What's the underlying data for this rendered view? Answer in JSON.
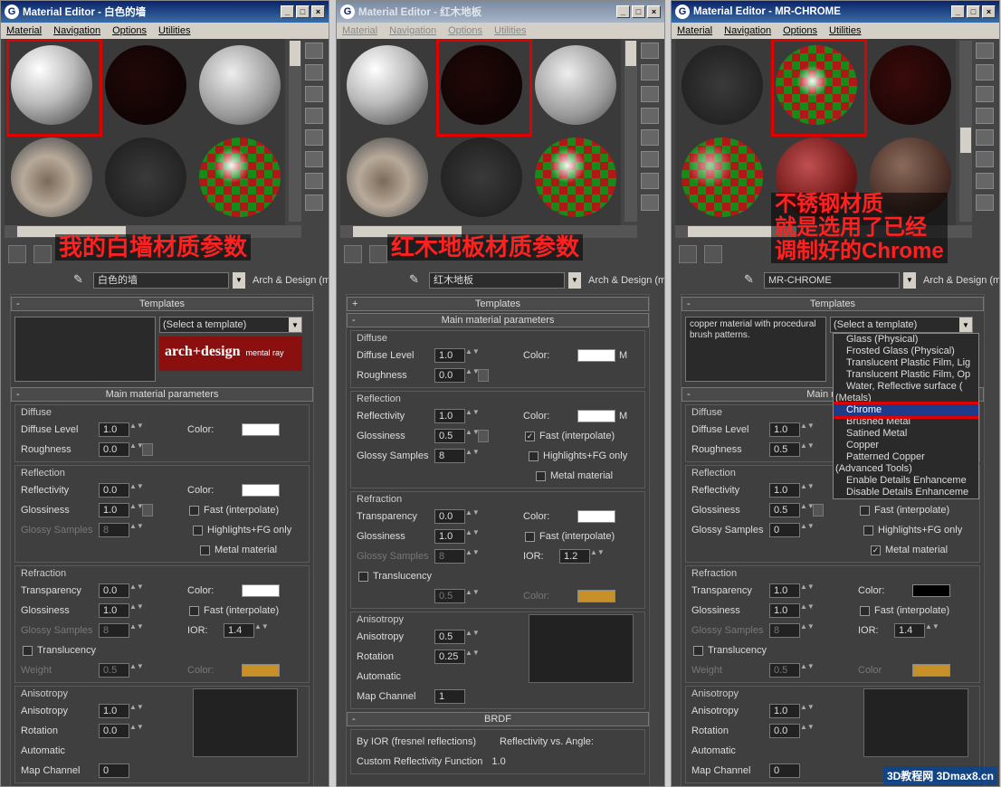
{
  "windows": [
    {
      "title": "Material Editor - 白色的墙",
      "menus": [
        "Material",
        "Navigation",
        "Options",
        "Utilities"
      ],
      "caption": "我的白墙材质参数",
      "material_name": "白色的墙",
      "material_type": "Arch & Design (mi)",
      "templates": {
        "label": "Templates",
        "select": "(Select a template)",
        "banner": "arch+design",
        "banner_sub": "mental ray"
      },
      "main_label": "Main material parameters",
      "diffuse": {
        "title": "Diffuse",
        "level_label": "Diffuse Level",
        "level": "1.0",
        "rough_label": "Roughness",
        "rough": "0.0",
        "color_label": "Color:"
      },
      "reflection": {
        "title": "Reflection",
        "refl_label": "Reflectivity",
        "refl": "0.0",
        "gloss_label": "Glossiness",
        "gloss": "1.0",
        "samples_label": "Glossy Samples",
        "samples": "8",
        "fast": "Fast (interpolate)",
        "highlights": "Highlights+FG only",
        "metal": "Metal material"
      },
      "refraction": {
        "title": "Refraction",
        "trans_label": "Transparency",
        "trans": "0.0",
        "gloss_label": "Glossiness",
        "gloss": "1.0",
        "samples_label": "Glossy Samples",
        "samples": "8",
        "fast": "Fast (interpolate)",
        "ior_label": "IOR:",
        "ior": "1.4",
        "translucency": "Translucency",
        "weight_label": "Weight",
        "weight": "0.5",
        "color_label": "Color:"
      },
      "anisotropy": {
        "title": "Anisotropy",
        "aniso_label": "Anisotropy",
        "aniso": "1.0",
        "rot_label": "Rotation",
        "rot": "0.0",
        "auto": "Automatic",
        "map": "Map Channel",
        "map_val": "0"
      }
    },
    {
      "title": "Material Editor - 红木地板",
      "menus": [
        "Material",
        "Navigation",
        "Options",
        "Utilities"
      ],
      "caption": "红木地板材质参数",
      "material_name": "红木地板",
      "material_type": "Arch & Design (mi)",
      "templates": {
        "label": "Templates"
      },
      "main_label": "Main material parameters",
      "diffuse": {
        "title": "Diffuse",
        "level_label": "Diffuse Level",
        "level": "1.0",
        "rough_label": "Roughness",
        "rough": "0.0",
        "color_label": "Color:",
        "m": "M"
      },
      "reflection": {
        "title": "Reflection",
        "refl_label": "Reflectivity",
        "refl": "1.0",
        "gloss_label": "Glossiness",
        "gloss": "0.5",
        "samples_label": "Glossy Samples",
        "samples": "8",
        "color_label": "Color:",
        "m": "M",
        "fast": "Fast (interpolate)",
        "highlights": "Highlights+FG only",
        "metal": "Metal material"
      },
      "refraction": {
        "title": "Refraction",
        "trans_label": "Transparency",
        "trans": "0.0",
        "gloss_label": "Glossiness",
        "gloss": "1.0",
        "samples_label": "Glossy Samples",
        "samples": "8",
        "color_label": "Color:",
        "fast": "Fast (interpolate)",
        "ior_label": "IOR:",
        "ior": "1.2",
        "translucency": "Translucency",
        "weight": "0.5"
      },
      "anisotropy": {
        "title": "Anisotropy",
        "aniso_label": "Anisotropy",
        "aniso": "0.5",
        "rot_label": "Rotation",
        "rot": "0.25",
        "auto": "Automatic",
        "map": "Map Channel",
        "map_val": "1"
      },
      "brdf": {
        "title": "BRDF",
        "ior": "By IOR (fresnel reflections)",
        "custom": "Custom Reflectivity Function",
        "plot_label": "Reflectivity vs. Angle:",
        "plot_val": "1.0"
      }
    },
    {
      "title": "Material Editor - MR-CHROME",
      "menus": [
        "Material",
        "Navigation",
        "Options",
        "Utilities"
      ],
      "caption_lines": [
        "不锈钢材质",
        "就是选用了已经",
        "调制好的Chrome"
      ],
      "material_name": "MR-CHROME",
      "material_type": "Arch & Design (mi)",
      "templates": {
        "label": "Templates",
        "description": "copper material with procedural brush patterns.",
        "select": "(Select a template)"
      },
      "main_label": "Main materi",
      "dropdown": [
        "Glass (Physical)",
        "Frosted Glass (Physical)",
        "Translucent Plastic Film, Lig",
        "Translucent Plastic Film, Op",
        "Water, Reflective surface (",
        "(Metals)",
        "Chrome",
        "Brushed Metal",
        "Satined Metal",
        "Copper",
        "Patterned Copper",
        "(Advanced Tools)",
        "Enable Details Enhanceme",
        "Disable Details Enhanceme"
      ],
      "dropdown_selected": "Chrome",
      "diffuse": {
        "title": "Diffuse",
        "level_label": "Diffuse Level",
        "level": "1.0",
        "rough_label": "Roughness",
        "rough": "0.5"
      },
      "reflection": {
        "title": "Reflection",
        "refl_label": "Reflectivity",
        "refl": "1.0",
        "gloss_label": "Glossiness",
        "gloss": "0.5",
        "samples_label": "Glossy Samples",
        "samples": "0",
        "fast": "Fast (interpolate)",
        "highlights": "Highlights+FG only",
        "metal": "Metal material"
      },
      "refraction": {
        "title": "Refraction",
        "trans_label": "Transparency",
        "trans": "1.0",
        "gloss_label": "Glossiness",
        "gloss": "1.0",
        "samples_label": "Glossy Samples",
        "samples": "8",
        "color_label": "Color:",
        "fast": "Fast (interpolate)",
        "ior_label": "IOR:",
        "ior": "1.4",
        "translucency": "Translucency",
        "weight_label": "Weight",
        "weight": "0.5",
        "color2_label": "Color"
      },
      "anisotropy": {
        "title": "Anisotropy",
        "aniso_label": "Anisotropy",
        "aniso": "1.0",
        "rot_label": "Rotation",
        "rot": "0.0",
        "auto": "Automatic",
        "map": "Map Channel",
        "map_val": "0"
      }
    }
  ],
  "watermark": "3D教程网 3Dmax8.cn"
}
